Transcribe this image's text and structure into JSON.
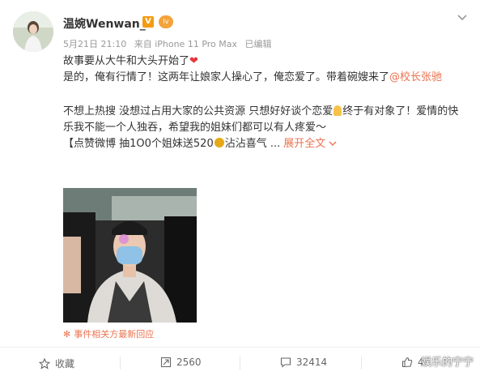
{
  "post": {
    "username": "温婉Wenwan_",
    "verified_badge": "V",
    "level_badge": "lv",
    "timestamp": "5月21日 21:10",
    "source": "来自 iPhone 11 Pro Max",
    "edited": "已编辑",
    "line1": "故事要从大牛和大头开始了",
    "line2_text": "是的，俺有行情了！这两年让娘家人操心了，俺恋爱了。带着碗嫂来了",
    "mention": "@校长张驰",
    "para2_part1": "不想上热搜 没想过占用大家的公共资源 只想好好谈个恋爱",
    "para2_part2": "终于有对象了！爱情的快乐我不能一个人独吞，希望我的姐妹们都可以有人疼爱～",
    "para3_part1": "【点赞微博 抽1O0个姐妹送520",
    "para3_part2": "沾沾喜气 ...",
    "expand_label": "展开全文",
    "event_link": "事件相关方最新回应"
  },
  "actions": {
    "favorite_label": "收藏",
    "repost_count": "2560",
    "comment_count": "32414",
    "like_count": "4"
  },
  "watermark": "娱乐的宁宁",
  "icons": {
    "chevron": "chevron-down-icon",
    "heart": "heart-icon",
    "star": "star-icon",
    "repost": "repost-icon",
    "comment": "comment-icon",
    "like": "like-icon"
  }
}
